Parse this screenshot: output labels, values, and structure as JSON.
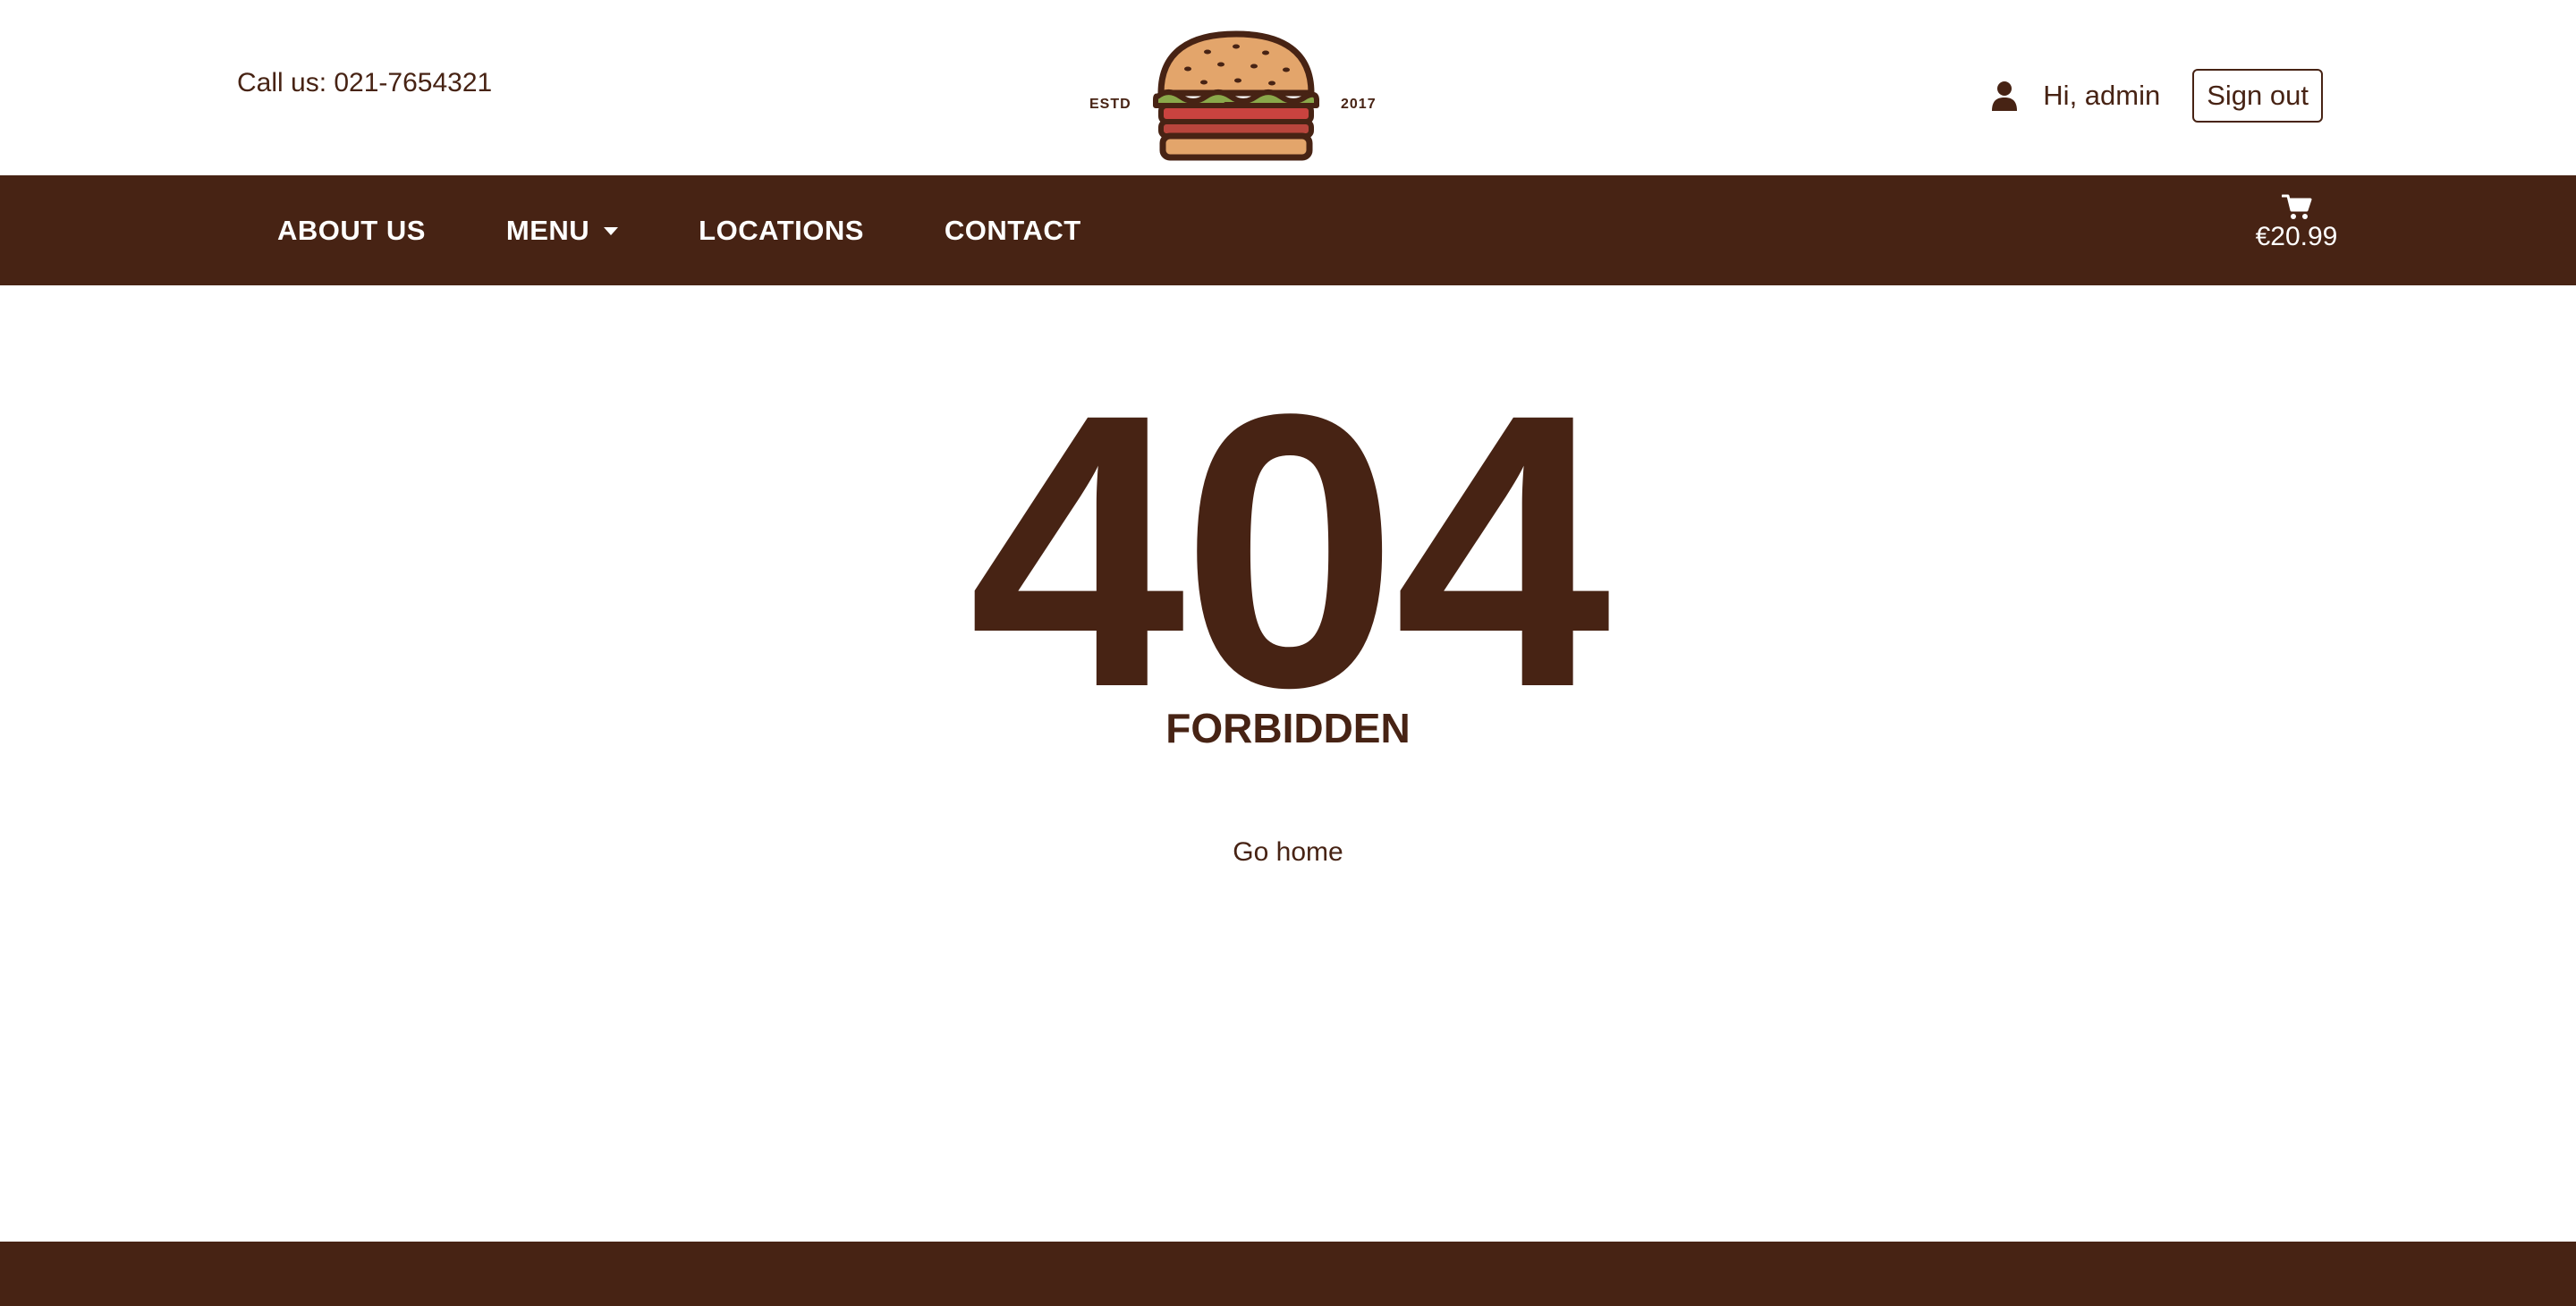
{
  "header": {
    "phone_text": "Call us: 021-7654321",
    "logo": {
      "left_text": "ESTD",
      "right_text": "2017",
      "icon": "burger-icon"
    },
    "user": {
      "icon": "user-icon",
      "greeting": "Hi, admin",
      "signout_label": "Sign out"
    }
  },
  "nav": {
    "items": [
      {
        "label": "ABOUT US"
      },
      {
        "label": "MENU",
        "has_dropdown": true
      },
      {
        "label": "LOCATIONS"
      },
      {
        "label": "CONTACT"
      }
    ],
    "cart": {
      "icon": "cart-icon",
      "total": "€20.99"
    }
  },
  "error": {
    "code": "404",
    "message": "FORBIDDEN",
    "link_label": "Go home"
  },
  "colors": {
    "brand_brown": "#472314",
    "background": "#ffffff",
    "bun": "#e3a56b",
    "lettuce": "#8aa84a",
    "tomato": "#c9433f",
    "patty": "#7a3a22"
  }
}
